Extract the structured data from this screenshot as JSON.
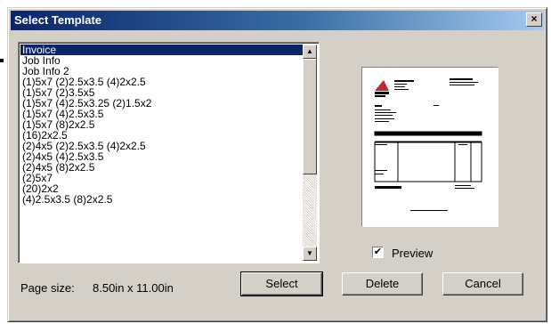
{
  "window": {
    "title": "Select Template",
    "close_glyph": "×"
  },
  "templates": {
    "selected_index": 0,
    "items": [
      "Invoice",
      "Job Info",
      "Job Info 2",
      "(1)5x7 (2)2.5x3.5 (4)2x2.5",
      "(1)5x7 (2)3.5x5",
      "(1)5x7 (4)2.5x3.25 (2)1.5x2",
      "(1)5x7 (4)2.5x3.5",
      "(1)5x7 (8)2x2.5",
      "(16)2x2.5",
      "(2)4x5 (2)2.5x3.5 (4)2x2.5",
      "(2)4x5 (4)2.5x3.5",
      "(2)4x5 (8)2x2.5",
      "(2)5x7",
      "(20)2x2",
      "(4)2.5x3.5 (8)2x2.5"
    ]
  },
  "preview": {
    "label": "Preview",
    "checked": true,
    "check_glyph": "✔"
  },
  "page_size": {
    "label": "Page size:",
    "value": "8.50in x 11.00in"
  },
  "buttons": {
    "select": "Select",
    "delete": "Delete",
    "cancel": "Cancel"
  },
  "icons": {
    "scroll_up": "▲",
    "scroll_down": "▼"
  },
  "colors": {
    "selection": "#0a246a",
    "face": "#d4d0c8",
    "logo_red": "#c0282d"
  }
}
